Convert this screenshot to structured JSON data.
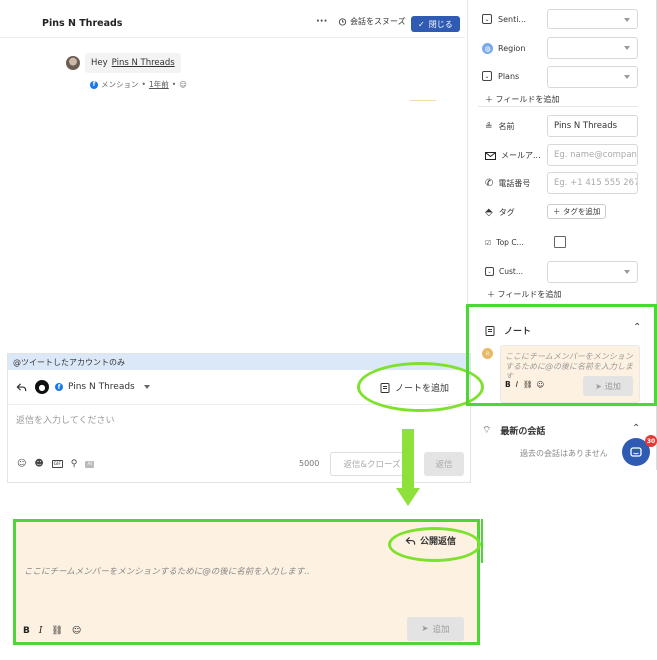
{
  "header": {
    "title": "Pins N Threads",
    "more_label": "···",
    "snooze_label": "会話をスヌーズ",
    "close_label": "閉じる"
  },
  "message": {
    "greeting": "Hey",
    "mention": "Pins N Threads",
    "meta_source": "メンション",
    "meta_time": "1年前",
    "separator": "•"
  },
  "composer": {
    "banner": "@ツイートしたアカウントのみ",
    "account_name": "Pins N Threads",
    "add_note_label": "ノートを追加",
    "reply_placeholder": "返信を入力してください",
    "char_count": "5000",
    "reply_close_label": "返信&クローズ",
    "reply_label": "返信"
  },
  "note_editor": {
    "public_reply_label": "公開返信",
    "placeholder": "ここにチームメンバーをメンションするために@の後に名前を入力します..",
    "add_label": "追加",
    "toolbar": [
      "B",
      "I"
    ]
  },
  "sidebar": {
    "fields_top": [
      {
        "label": "Senti...",
        "icon": "sentiment-icon"
      },
      {
        "label": "Region",
        "icon": "globe-icon"
      },
      {
        "label": "Plans",
        "icon": "plans-icon"
      }
    ],
    "add_field_label": "＋ フィールドを追加",
    "contact": {
      "name_label": "名前",
      "name_value": "Pins N Threads",
      "email_label": "メールア...",
      "email_placeholder": "Eg. name@compan",
      "phone_label": "電話番号",
      "phone_placeholder": "Eg. +1 415 555 267",
      "tag_label": "タグ",
      "add_tag_label": "＋ タグを追加",
      "topc_label": "Top C...",
      "cust_label": "Cust..."
    },
    "add_field_label_2": "＋ フィールドを追加",
    "notes": {
      "title": "ノート",
      "placeholder": "ここにチームメンバーをメンションするために@の後に名前を入力します..",
      "add_label": "追加"
    },
    "recent": {
      "title": "最新の会話",
      "empty": "過去の会話はありません"
    },
    "chat_badge": "30"
  },
  "colors": {
    "accent_green": "#4cd637",
    "primary_blue": "#2f5bb3",
    "note_bg": "#fdf1e1",
    "banner_bg": "#dbe8f8"
  }
}
